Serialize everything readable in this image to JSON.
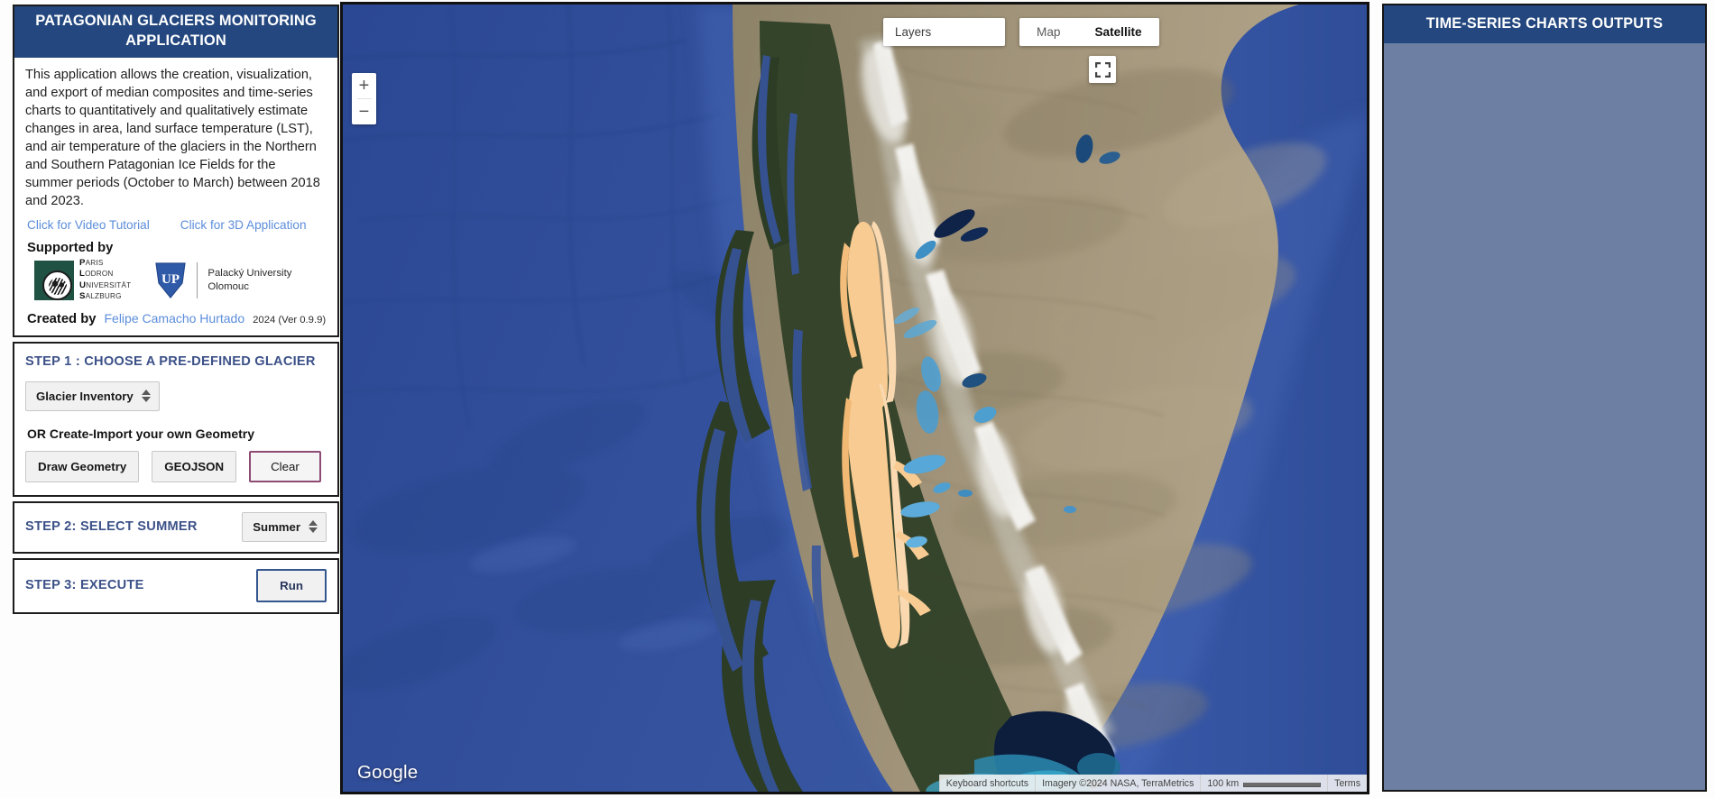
{
  "app": {
    "title": "PATAGONIAN GLACIERS MONITORING APPLICATION",
    "description": "This application allows the creation, visualization, and export of median composites and time-series charts to quantitatively and qualitatively estimate changes in area, land surface temperature (LST), and air temperature of the glaciers in the Northern and Southern Patagonian Ice Fields for the summer periods (October to March) between 2018 and 2023.",
    "links": [
      {
        "label": "Click for Video Tutorial",
        "name": "video-tutorial-link"
      },
      {
        "label": "Click for 3D Application",
        "name": "3d-application-link"
      }
    ],
    "supported_by_label": "Supported by",
    "logos": [
      {
        "name": "paris-lodron-universitat-salzburg-logo",
        "lines": [
          {
            "initial": "P",
            "rest": "ARIS"
          },
          {
            "initial": "L",
            "rest": "ODRON"
          },
          {
            "initial": "U",
            "rest": "NIVERSITÄT"
          },
          {
            "initial": "S",
            "rest": "ALZBURG"
          }
        ]
      },
      {
        "name": "palacky-university-olomouc-logo",
        "line1": "Palacký University",
        "line2": "Olomouc"
      }
    ],
    "created_by_label": "Created by",
    "author": "Felipe Camacho Hurtado",
    "version": "2024 (Ver 0.9.9)"
  },
  "step1": {
    "title": "STEP 1 : CHOOSE A PRE-DEFINED GLACIER",
    "select_value": "Glacier Inventory",
    "or_label": "OR Create-Import your own Geometry",
    "buttons": [
      {
        "label": "Draw Geometry",
        "name": "draw-geometry-button"
      },
      {
        "label": "GEOJSON",
        "name": "geojson-button"
      },
      {
        "label": "Clear",
        "name": "clear-button"
      }
    ]
  },
  "step2": {
    "title": "STEP 2: SELECT SUMMER",
    "select_value": "Summer"
  },
  "step3": {
    "title": "STEP 3: EXECUTE",
    "run_label": "Run"
  },
  "map": {
    "layers_label": "Layers",
    "maptypes": [
      {
        "label": "Map",
        "active": false
      },
      {
        "label": "Satellite",
        "active": true
      }
    ],
    "zoom_in": "+",
    "zoom_out": "−",
    "google_logo": "Google",
    "attribution": {
      "keyboard_shortcuts": "Keyboard shortcuts",
      "imagery": "Imagery ©2024 NASA, TerraMetrics",
      "scale": "100 km",
      "terms": "Terms"
    }
  },
  "right_panel": {
    "title": "TIME-SERIES CHARTS OUTPUTS"
  },
  "colors": {
    "header_blue": "#23477e",
    "step_title_blue": "#3c5188",
    "link_blue": "#5b8ddb",
    "clear_border": "#8d4a73",
    "run_border": "#34558e",
    "right_panel_body": "#6d80a4",
    "glacier_orange": "#f7c98f",
    "ocean_blue": "#2e4d96"
  }
}
